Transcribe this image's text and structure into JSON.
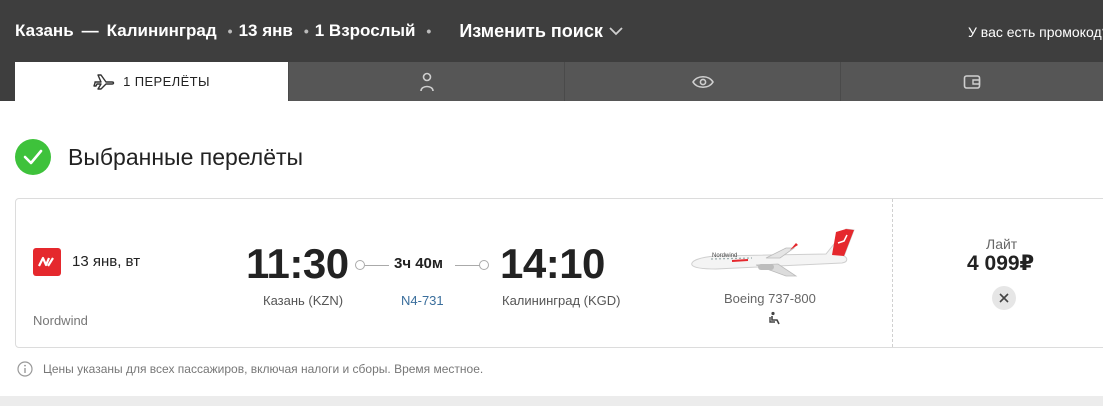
{
  "search": {
    "origin": "Казань",
    "separator": "—",
    "destination": "Калининград",
    "date": "13 янв",
    "passengers": "1 Взрослый",
    "change_label": "Изменить поиск",
    "promo_text": "У вас есть промокод?"
  },
  "tabs": [
    {
      "label": "1  ПЕРЕЛЁТЫ",
      "icon": "plane-icon",
      "active": true
    },
    {
      "label": "",
      "icon": "person-icon",
      "active": false
    },
    {
      "label": "",
      "icon": "eye-icon",
      "active": false
    },
    {
      "label": "",
      "icon": "wallet-icon",
      "active": false
    }
  ],
  "section": {
    "title": "Выбранные перелёты"
  },
  "flight": {
    "date": "13 янв, вт",
    "airline": "Nordwind",
    "departure_time": "11:30",
    "departure_city": "Казань (KZN)",
    "arrival_time": "14:10",
    "arrival_city": "Калининград (KGD)",
    "duration": "3ч 40м",
    "flight_number": "N4-731",
    "aircraft": "Boeing 737-800",
    "fare_name": "Лайт",
    "price": "4 099₽"
  },
  "note": {
    "text": "Цены указаны для всех пассажиров, включая налоги и сборы. Время местное."
  },
  "colors": {
    "topbar": "#3e3e3e",
    "tabs_bg": "#565656",
    "success_green": "#3ec23b",
    "brand_red": "#e5282d",
    "link_blue": "#3a6e9c"
  }
}
